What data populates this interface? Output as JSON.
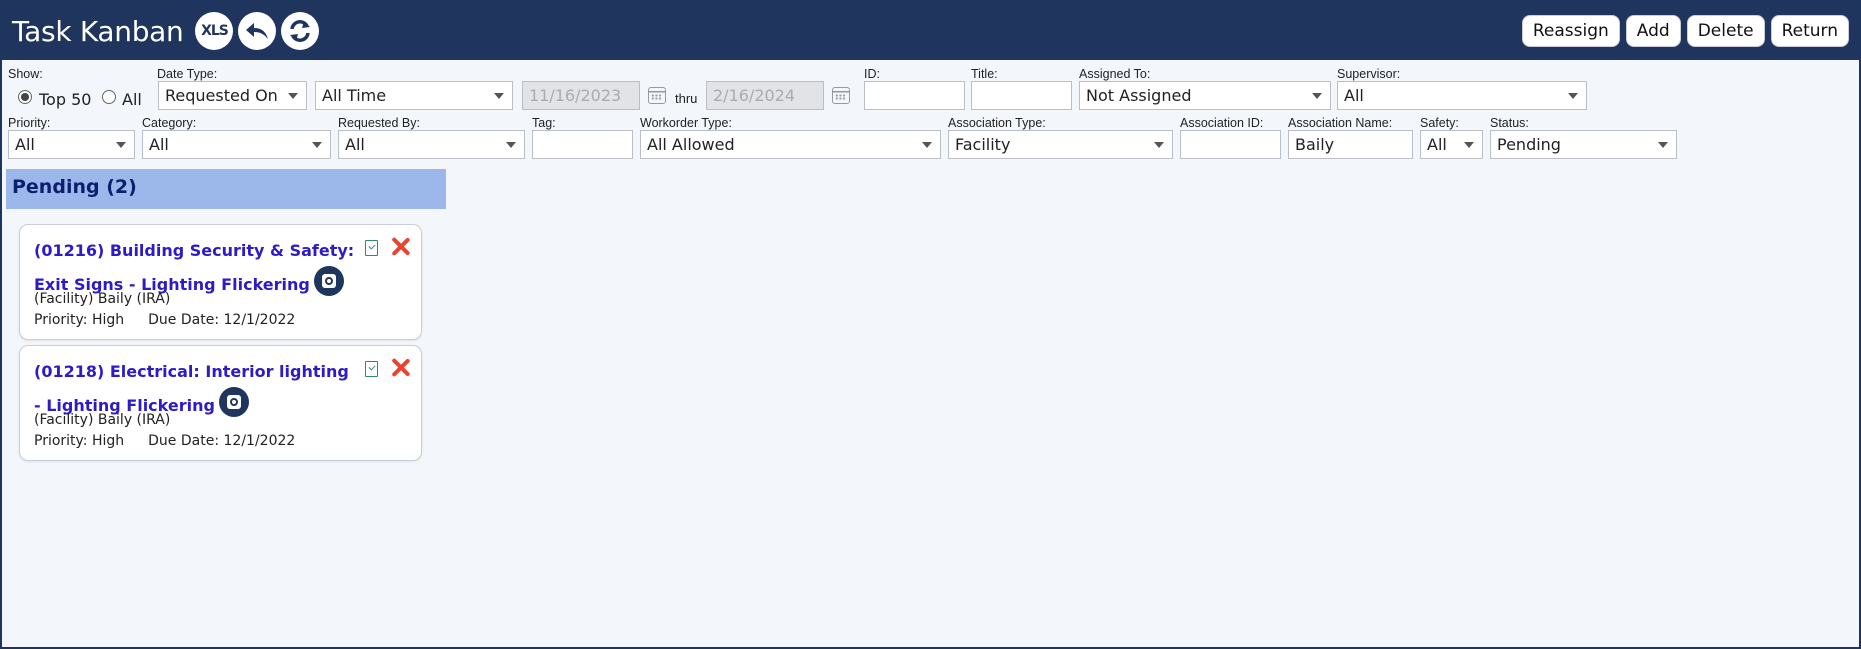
{
  "header": {
    "title": "Task Kanban",
    "xls_label": "XLS",
    "actions": [
      "Reassign",
      "Add",
      "Delete",
      "Return"
    ],
    "icons": [
      "xls-export-icon",
      "back-arrow-icon",
      "refresh-icon"
    ]
  },
  "filters": {
    "show_label": "Show:",
    "show_options": [
      "Top 50",
      "All"
    ],
    "show_selected": "Top 50",
    "date_type_label": "Date Type:",
    "date_type_value": "Requested On",
    "date_range_value": "All Time",
    "date_from": "11/16/2023",
    "thru_label": "thru",
    "date_to": "2/16/2024",
    "id_label": "ID:",
    "id_value": "",
    "title_label": "Title:",
    "title_value": "",
    "assigned_to_label": "Assigned To:",
    "assigned_to_value": "Not Assigned",
    "supervisor_label": "Supervisor:",
    "supervisor_value": "All",
    "priority_label": "Priority:",
    "priority_value": "All",
    "category_label": "Category:",
    "category_value": "All",
    "requested_by_label": "Requested By:",
    "requested_by_value": "All",
    "tag_label": "Tag:",
    "tag_value": "",
    "workorder_type_label": "Workorder Type:",
    "workorder_type_value": "All Allowed",
    "association_type_label": "Association Type:",
    "association_type_value": "Facility",
    "association_id_label": "Association ID:",
    "association_id_value": "",
    "association_name_label": "Association Name:",
    "association_name_value": "Baily",
    "safety_label": "Safety:",
    "safety_value": "All",
    "status_label": "Status:",
    "status_value": "Pending"
  },
  "group": {
    "title": "Pending (2)"
  },
  "cards": [
    {
      "title": "(01216) Building Security & Safety: Exit Signs - Lighting Flickering",
      "association": "(Facility) Baily (IRA)",
      "priority": "Priority: High",
      "due": "Due Date: 12/1/2022"
    },
    {
      "title": "(01218) Electrical: Interior lighting - Lighting Flickering",
      "association": "(Facility) Baily (IRA)",
      "priority": "Priority: High",
      "due": "Due Date: 12/1/2022"
    }
  ]
}
